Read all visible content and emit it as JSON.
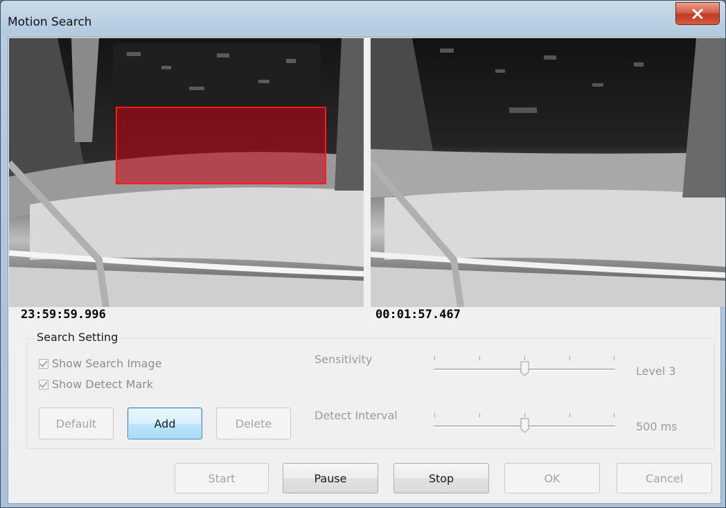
{
  "window": {
    "title": "Motion Search"
  },
  "videos": {
    "left_timestamp": "23:59:59.996",
    "right_timestamp": "00:01:57.467"
  },
  "search_setting": {
    "group_label": "Search Setting",
    "show_search_image": {
      "label": "Show Search Image",
      "checked": true
    },
    "show_detect_mark": {
      "label": "Show Detect Mark",
      "checked": true
    },
    "sensitivity": {
      "label": "Sensitivity",
      "value_text": "Level 3",
      "level": 3,
      "min": 1,
      "max": 5
    },
    "detect_interval": {
      "label": "Detect Interval",
      "value_text": "500 ms"
    },
    "buttons": {
      "default": "Default",
      "add": "Add",
      "delete": "Delete"
    }
  },
  "footer_buttons": {
    "start": "Start",
    "pause": "Pause",
    "stop": "Stop",
    "ok": "OK",
    "cancel": "Cancel"
  },
  "colors": {
    "motion_region": "#c80014",
    "close_button": "#c23a22",
    "focus_border": "#3c7fb1"
  },
  "icons": {
    "close": "close-x-icon",
    "checkbox": "checkmark-icon",
    "slider_thumb": "slider-thumb-icon"
  }
}
